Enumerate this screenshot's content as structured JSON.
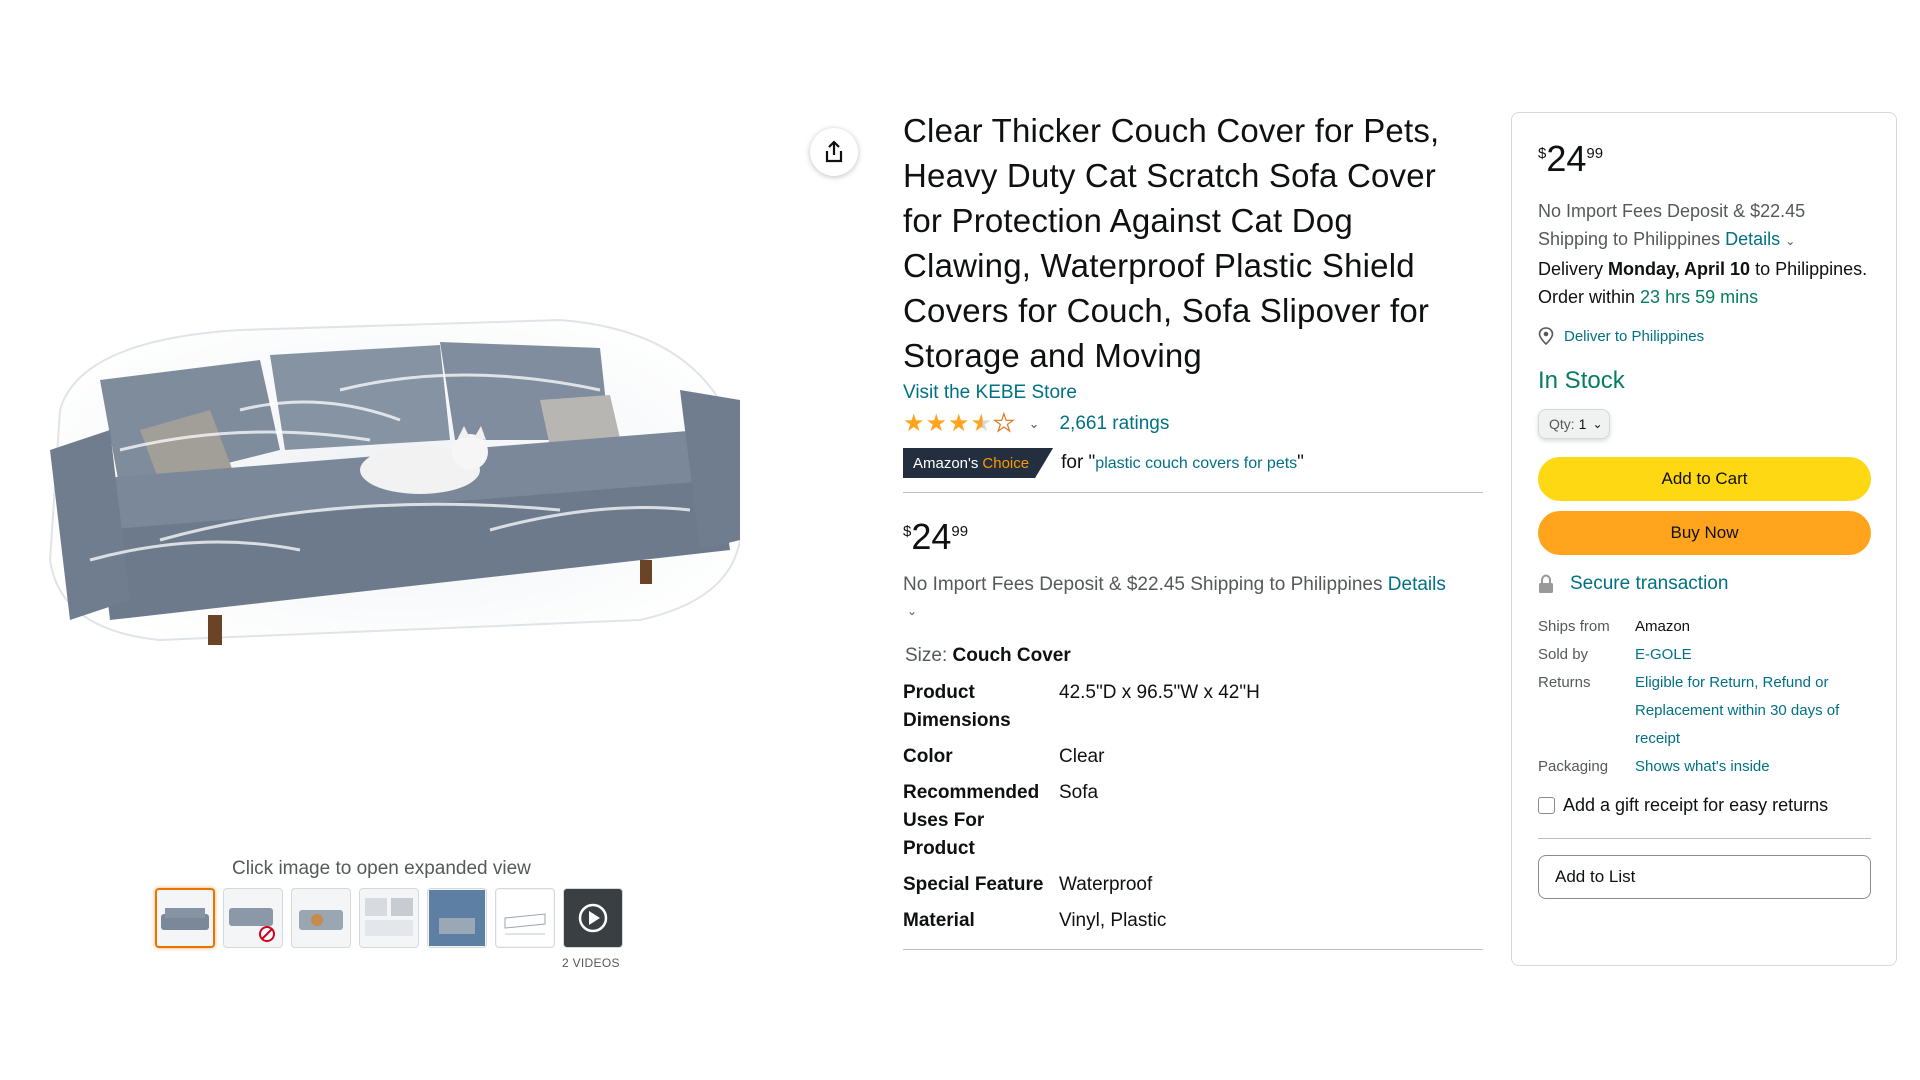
{
  "product": {
    "title": "Clear Thicker Couch Cover for Pets, Heavy Duty Cat Scratch Sofa Cover for Protection Against Cat Dog Clawing, Waterproof Plastic Shield Covers for Couch, Sofa Slipover for Storage and Moving",
    "store_link": "Visit the KEBE Store",
    "rating_stars": 3.5,
    "ratings_count": "2,661 ratings",
    "choice_badge_prefix": "Amazon's",
    "choice_badge_highlight": "Choice",
    "choice_for": "for \"",
    "choice_query": "plastic couch covers for pets",
    "choice_close": "\"",
    "icons": {
      "share": "share-icon",
      "stars": "star-icon",
      "chevron": "chevron-down-icon"
    }
  },
  "gallery": {
    "click_hint": "Click image to open expanded view",
    "videos_label": "2 VIDEOS",
    "thumbnails": [
      "thumb-1",
      "thumb-2",
      "thumb-3",
      "thumb-4",
      "thumb-5",
      "thumb-6",
      "thumb-video"
    ],
    "selected_index": 0
  },
  "pricing": {
    "symbol": "$",
    "whole": "24",
    "fraction": "99",
    "shipping_text": "No Import Fees Deposit & $22.45 Shipping to Philippines",
    "details_link": "Details"
  },
  "size": {
    "label": "Size:",
    "value": "Couch Cover"
  },
  "specs": [
    {
      "key": "Product Dimensions",
      "value": "42.5\"D x 96.5\"W x 42\"H"
    },
    {
      "key": "Color",
      "value": "Clear"
    },
    {
      "key": "Recommended Uses For Product",
      "value": "Sofa"
    },
    {
      "key": "Special Feature",
      "value": "Waterproof"
    },
    {
      "key": "Material",
      "value": "Vinyl, Plastic"
    }
  ],
  "buybox": {
    "shipping_line_1": "No Import Fees Deposit & $22.45",
    "shipping_line_2": "Shipping to Philippines",
    "details_link": "Details",
    "delivery_prefix": "Delivery",
    "delivery_date": "Monday, April 10",
    "delivery_to": "to Philippines. Order within",
    "delivery_countdown": "23 hrs 59 mins",
    "deliver_to_link": "Deliver to Philippines",
    "stock": "In Stock",
    "qty_label": "Qty:",
    "qty_value": "1",
    "add_to_cart": "Add to Cart",
    "buy_now": "Buy Now",
    "secure": "Secure transaction",
    "info": {
      "ships_from_label": "Ships from",
      "ships_from": "Amazon",
      "sold_by_label": "Sold by",
      "sold_by": "E-GOLE",
      "returns_label": "Returns",
      "returns": "Eligible for Return, Refund or Replacement within 30 days of receipt",
      "packaging_label": "Packaging",
      "packaging": "Shows what's inside"
    },
    "gift_receipt": "Add a gift receipt for easy returns",
    "add_to_list": "Add to List"
  },
  "colors": {
    "link": "#007185",
    "in_stock": "#067d62",
    "add_to_cart": "#ffd814",
    "buy_now": "#ffa41c",
    "badge_bg": "#232f3e",
    "badge_accent": "#ff9900"
  }
}
